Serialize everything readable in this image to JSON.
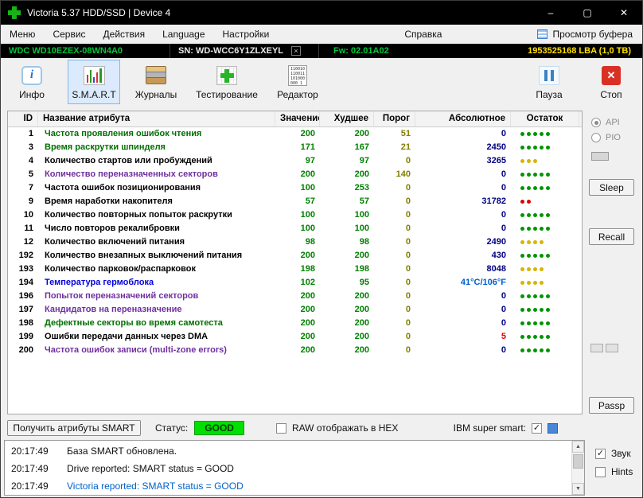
{
  "icons": {
    "minimize_glyph": "–",
    "maximize_glyph": "▢",
    "close_glyph": "✕",
    "check_glyph": "✓",
    "serial_close_glyph": "×",
    "info_glyph": "i",
    "stop_glyph": "✕",
    "scroll_up_glyph": "▲",
    "scroll_down_glyph": "▼",
    "editor_binary_text": "110010\n110011\n101000\n000  1"
  },
  "window": {
    "title": "Victoria 5.37 HDD/SSD | Device 4"
  },
  "menubar": {
    "items": [
      {
        "label": "Меню"
      },
      {
        "label": "Сервис"
      },
      {
        "label": "Действия"
      },
      {
        "label": "Language"
      },
      {
        "label": "Настройки"
      },
      {
        "label": "Справка"
      }
    ],
    "buffer_view_label": "Просмотр буфера"
  },
  "device_bar": {
    "model": "WDC WD10EZEX-08WN4A0",
    "serial": "SN: WD-WCC6Y1ZLXEYL",
    "firmware": "Fw: 02.01A02",
    "capacity": "1953525168 LBA (1,0 ТВ)",
    "model_color": "#00c83c",
    "firmware_color": "#00c83c",
    "capacity_color": "#ffe000"
  },
  "toolbar": {
    "info_label": "Инфо",
    "smart_label": "S.M.A.R.T",
    "journals_label": "Журналы",
    "testing_label": "Тестирование",
    "editor_label": "Редактор",
    "pause_label": "Пауза",
    "stop_label": "Стоп"
  },
  "smart_table": {
    "headers": {
      "id": "ID",
      "name": "Название атрибута",
      "value": "Значение",
      "worst": "Худшее",
      "threshold": "Порог",
      "absolute": "Абсолютное",
      "remain": "Остаток"
    },
    "value_color": "#008000",
    "worst_color": "#008000",
    "threshold_color": "#808000",
    "rows": [
      {
        "id": "1",
        "name": "Частота проявления ошибок чтения",
        "name_color": "#007000",
        "value": "200",
        "worst": "200",
        "threshold": "51",
        "absolute": "0",
        "absolute_color": "#000080",
        "dots": 5,
        "dot_color": "#009500"
      },
      {
        "id": "3",
        "name": "Время раскрутки шпинделя",
        "name_color": "#007000",
        "value": "171",
        "worst": "167",
        "threshold": "21",
        "absolute": "2450",
        "absolute_color": "#000080",
        "dots": 5,
        "dot_color": "#009500"
      },
      {
        "id": "4",
        "name": "Количество стартов или пробуждений",
        "name_color": "#000000",
        "value": "97",
        "worst": "97",
        "threshold": "0",
        "absolute": "3265",
        "absolute_color": "#000080",
        "dots": 3,
        "dot_color": "#d8b400"
      },
      {
        "id": "5",
        "name": "Количество переназначенных секторов",
        "name_color": "#7030a0",
        "value": "200",
        "worst": "200",
        "threshold": "140",
        "absolute": "0",
        "absolute_color": "#000080",
        "dots": 5,
        "dot_color": "#009500"
      },
      {
        "id": "7",
        "name": "Частота ошибок позиционирования",
        "name_color": "#000000",
        "value": "100",
        "worst": "253",
        "threshold": "0",
        "absolute": "0",
        "absolute_color": "#000080",
        "dots": 5,
        "dot_color": "#009500"
      },
      {
        "id": "9",
        "name": "Время наработки накопителя",
        "name_color": "#000000",
        "value": "57",
        "worst": "57",
        "threshold": "0",
        "absolute": "31782",
        "absolute_color": "#000080",
        "dots": 2,
        "dot_color": "#e00000"
      },
      {
        "id": "10",
        "name": "Количество повторных попыток раскрутки",
        "name_color": "#000000",
        "value": "100",
        "worst": "100",
        "threshold": "0",
        "absolute": "0",
        "absolute_color": "#000080",
        "dots": 5,
        "dot_color": "#009500"
      },
      {
        "id": "11",
        "name": "Число повторов рекалибровки",
        "name_color": "#000000",
        "value": "100",
        "worst": "100",
        "threshold": "0",
        "absolute": "0",
        "absolute_color": "#000080",
        "dots": 5,
        "dot_color": "#009500"
      },
      {
        "id": "12",
        "name": "Количество включений питания",
        "name_color": "#000000",
        "value": "98",
        "worst": "98",
        "threshold": "0",
        "absolute": "2490",
        "absolute_color": "#000080",
        "dots": 4,
        "dot_color": "#d8b400"
      },
      {
        "id": "192",
        "name": "Количество внезапных выключений питания",
        "name_color": "#000000",
        "value": "200",
        "worst": "200",
        "threshold": "0",
        "absolute": "430",
        "absolute_color": "#000080",
        "dots": 5,
        "dot_color": "#009500"
      },
      {
        "id": "193",
        "name": "Количество парковок/распарковок",
        "name_color": "#000000",
        "value": "198",
        "worst": "198",
        "threshold": "0",
        "absolute": "8048",
        "absolute_color": "#000080",
        "dots": 4,
        "dot_color": "#d8b400"
      },
      {
        "id": "194",
        "name": "Температура гермоблока",
        "name_color": "#0000e0",
        "value": "102",
        "worst": "95",
        "threshold": "0",
        "absolute": "41°C/106°F",
        "absolute_color": "#0060d0",
        "dots": 4,
        "dot_color": "#d8b400"
      },
      {
        "id": "196",
        "name": "Попыток переназначений секторов",
        "name_color": "#7030a0",
        "value": "200",
        "worst": "200",
        "threshold": "0",
        "absolute": "0",
        "absolute_color": "#000080",
        "dots": 5,
        "dot_color": "#009500"
      },
      {
        "id": "197",
        "name": "Кандидатов на переназначение",
        "name_color": "#7030a0",
        "value": "200",
        "worst": "200",
        "threshold": "0",
        "absolute": "0",
        "absolute_color": "#000080",
        "dots": 5,
        "dot_color": "#009500"
      },
      {
        "id": "198",
        "name": "Дефектные секторы во время самотеста",
        "name_color": "#007000",
        "value": "200",
        "worst": "200",
        "threshold": "0",
        "absolute": "0",
        "absolute_color": "#000080",
        "dots": 5,
        "dot_color": "#009500"
      },
      {
        "id": "199",
        "name": "Ошибки передачи данных через DMA",
        "name_color": "#000000",
        "value": "200",
        "worst": "200",
        "threshold": "0",
        "absolute": "5",
        "absolute_color": "#e00000",
        "dots": 5,
        "dot_color": "#009500"
      },
      {
        "id": "200",
        "name": "Частота ошибок записи (multi-zone errors)",
        "name_color": "#7030a0",
        "value": "200",
        "worst": "200",
        "threshold": "0",
        "absolute": "0",
        "absolute_color": "#000080",
        "dots": 5,
        "dot_color": "#009500"
      }
    ]
  },
  "side_panel": {
    "api_label": "API",
    "pio_label": "PIO",
    "api_selected": true,
    "pio_selected": false,
    "sleep_label": "Sleep",
    "recall_label": "Recall",
    "passp_label": "Passp"
  },
  "status_bar": {
    "get_smart_label": "Получить атрибуты SMART",
    "status_label": "Статус:",
    "status_value": "GOOD",
    "status_good_bg": "#00e000",
    "raw_hex_label": "RAW отображать в HEX",
    "raw_hex_checked": false,
    "ibm_label": "IBM super smart:",
    "ibm_checked": true
  },
  "log": {
    "lines": [
      {
        "time": "20:17:49",
        "text": "База SMART обновлена.",
        "color": "#101010"
      },
      {
        "time": "20:17:49",
        "text": "Drive reported: SMART status = GOOD",
        "color": "#101010"
      },
      {
        "time": "20:17:49",
        "text": "Victoria reported: SMART status = GOOD",
        "color": "#0060c8"
      }
    ],
    "sound_label": "Звук",
    "sound_checked": true,
    "hints_label": "Hints",
    "hints_checked": false
  }
}
